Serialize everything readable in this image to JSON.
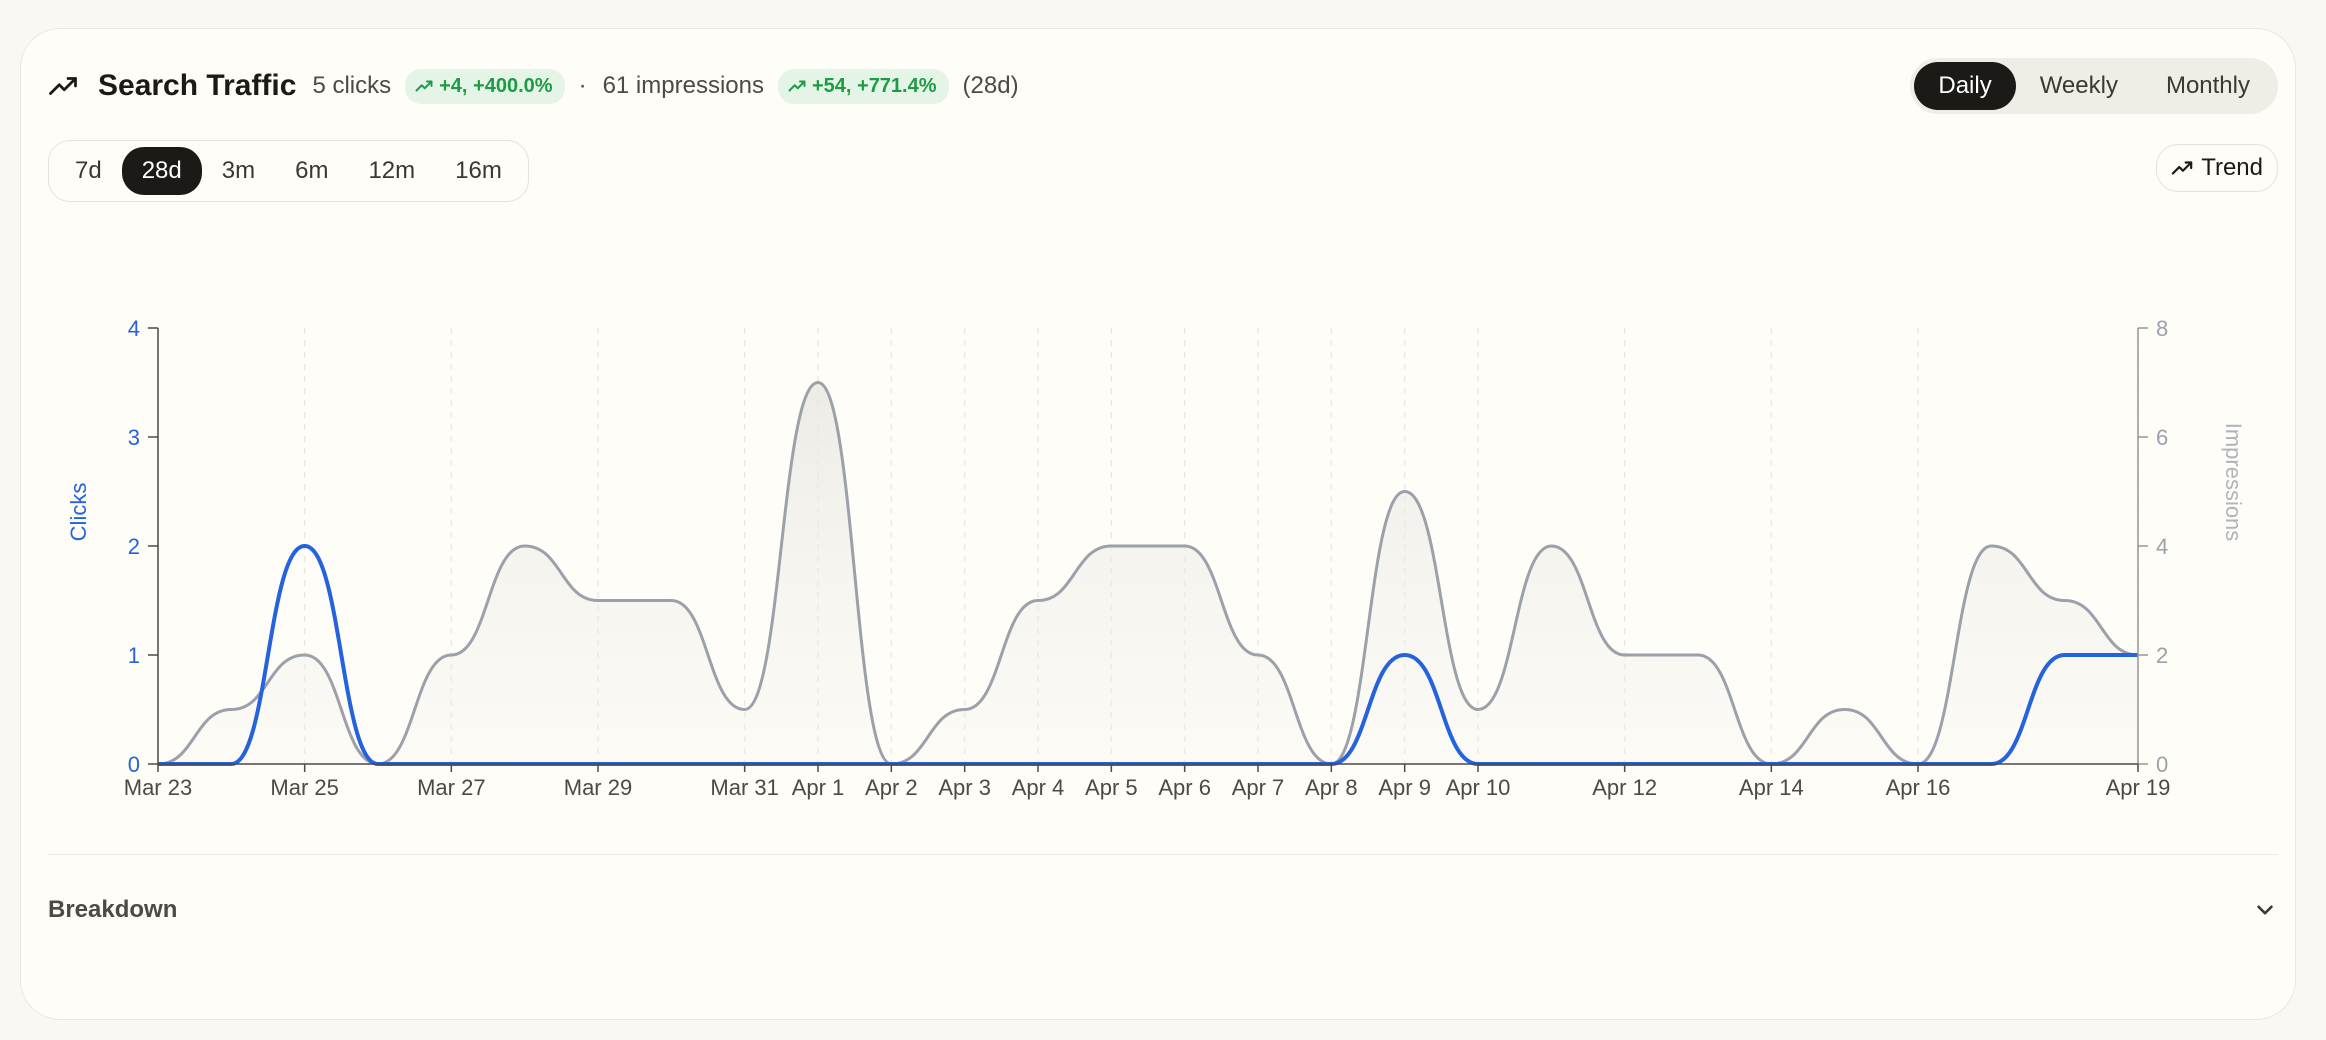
{
  "header": {
    "title": "Search Traffic",
    "clicks_text": "5 clicks",
    "clicks_delta": "+4, +400.0%",
    "separator": "·",
    "impressions_text": "61 impressions",
    "impressions_delta": "+54, +771.4%",
    "period": "(28d)"
  },
  "granularity": {
    "options": [
      "Daily",
      "Weekly",
      "Monthly"
    ],
    "selected": "Daily"
  },
  "ranges": {
    "options": [
      "7d",
      "28d",
      "3m",
      "6m",
      "12m",
      "16m"
    ],
    "selected": "28d"
  },
  "trend_label": "Trend",
  "breakdown_label": "Breakdown",
  "colors": {
    "clicks": "#2563de",
    "impressions": "#9ca0aa",
    "up": "#1f9a45"
  },
  "chart_data": {
    "type": "line",
    "x": [
      "Mar 23",
      "Mar 24",
      "Mar 25",
      "Mar 26",
      "Mar 27",
      "Mar 28",
      "Mar 29",
      "Mar 30",
      "Mar 31",
      "Apr 1",
      "Apr 2",
      "Apr 3",
      "Apr 4",
      "Apr 5",
      "Apr 6",
      "Apr 7",
      "Apr 8",
      "Apr 9",
      "Apr 10",
      "Apr 11",
      "Apr 12",
      "Apr 13",
      "Apr 14",
      "Apr 15",
      "Apr 16",
      "Apr 17",
      "Apr 18",
      "Apr 19"
    ],
    "x_tick_labels": [
      "Mar 23",
      "Mar 25",
      "Mar 27",
      "Mar 29",
      "Mar 31",
      "Apr 1",
      "Apr 2",
      "Apr 3",
      "Apr 4",
      "Apr 5",
      "Apr 6",
      "Apr 7",
      "Apr 8",
      "Apr 9",
      "Apr 10",
      "Apr 12",
      "Apr 14",
      "Apr 16",
      "Apr 19"
    ],
    "series": [
      {
        "name": "Clicks",
        "axis": "left",
        "values": [
          0,
          0,
          2,
          0,
          0,
          0,
          0,
          0,
          0,
          0,
          0,
          0,
          0,
          0,
          0,
          0,
          0,
          1,
          0,
          0,
          0,
          0,
          0,
          0,
          0,
          0,
          1,
          1
        ]
      },
      {
        "name": "Impressions",
        "axis": "right",
        "values": [
          0,
          1,
          2,
          0,
          2,
          4,
          3,
          3,
          1,
          7,
          0,
          1,
          3,
          4,
          4,
          2,
          0,
          5,
          1,
          4,
          2,
          2,
          0,
          1,
          0,
          4,
          3,
          2
        ]
      }
    ],
    "ylabel": "Clicks",
    "y2label": "Impressions",
    "ylim": [
      0,
      4
    ],
    "y2lim": [
      0,
      8
    ],
    "yticks": [
      0,
      1,
      2,
      3,
      4
    ],
    "y2ticks": [
      0,
      2,
      4,
      6,
      8
    ],
    "grid": "vertical-dashed"
  }
}
